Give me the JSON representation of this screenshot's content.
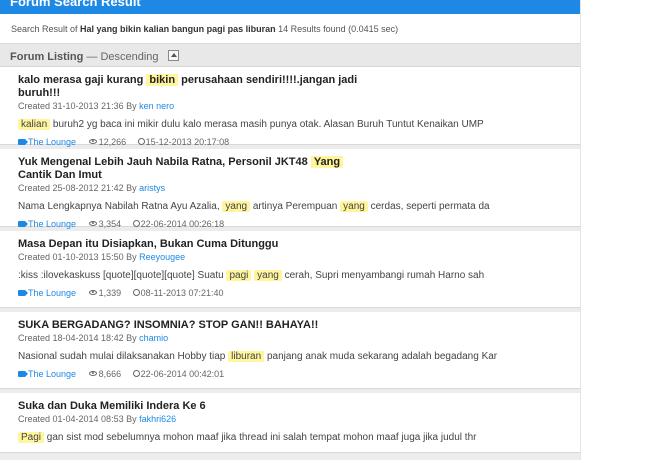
{
  "panel": {
    "title": "Forum Search Result"
  },
  "search": {
    "prefix": "Search Result of ",
    "query": "Hal yang bikin kalian bangun pagi pas liburan",
    "results": "14 Results found (0.0415 sec)"
  },
  "listing": {
    "title": "Forum Listing",
    "sort": "— Descending"
  },
  "threads": [
    {
      "title_a": "kalo merasa gaji kurang",
      "title_hl": "bikin",
      "title_b": "perusahaan sendiri!!!!.jangan jadi buruh!!!",
      "created": "Created 31-10-2013 21:36 By",
      "author": "ken nero",
      "snippet_hl1": "kalian",
      "snippet_rest": "buruh2 yg baca ini mikir dulu kalo merasa masih punya otak. Alasan Buruh Tuntut Kenaikan UMP",
      "forum": "The Lounge",
      "views": "12,266",
      "last": "15-12-2013 20:17:08"
    },
    {
      "title_a": "Yuk Mengenal Lebih Jauh Nabila Ratna, Personil JKT48",
      "title_hl": "Yang",
      "title_b": "Cantik Dan Imut",
      "created": "Created 25-08-2012 21:42 By",
      "author": "aristys",
      "snippet_a": "Nama Lengkapnya Nabilah Ratna Ayu Azalia,",
      "snippet_hl1": "yang",
      "snippet_b": "artinya Perempuan",
      "snippet_hl2": "yang",
      "snippet_c": "cerdas, seperti permata da",
      "forum": "The Lounge",
      "views": "3,354",
      "last": "22-06-2014 00:26:18"
    },
    {
      "title": "Masa Depan itu Disiapkan, Bukan Cuma Ditunggu",
      "created": "Created 01-10-2013 15:50 By",
      "author": "Reeyougee",
      "snippet_a": ":kiss :ilovekaskuss [quote][quote][quote] Suatu",
      "snippet_hl1": "pagi",
      "snippet_hl2": "yang",
      "snippet_b": "cerah, Supri menyambangi rumah Harno sah",
      "forum": "The Lounge",
      "views": "1,339",
      "last": "08-11-2013 07:21:40"
    },
    {
      "title": "SUKA BERGADANG? INSOMNIA? STOP GAN!! BAHAYA!!",
      "created": "Created 18-04-2014 18:42 By",
      "author": "chamio",
      "snippet_a": "Nasional sudah mulai dilaksanakan Hobby tiap",
      "snippet_hl1": "liburan",
      "snippet_b": "panjang anak muda sekarang adalah begadang Kar",
      "forum": "The Lounge",
      "views": "8,666",
      "last": "22-06-2014 00:42:01"
    },
    {
      "title": "Suka dan Duka Memiliki Indera Ke 6",
      "created": "Created 01-04-2014 08:53 By",
      "author": "fakhri626",
      "snippet_hl1": "Pagi",
      "snippet_rest": "gan sist mod sebelumnya mohon maaf jika thread ini salah tempat mohon maaf juga jika judul thr"
    }
  ]
}
